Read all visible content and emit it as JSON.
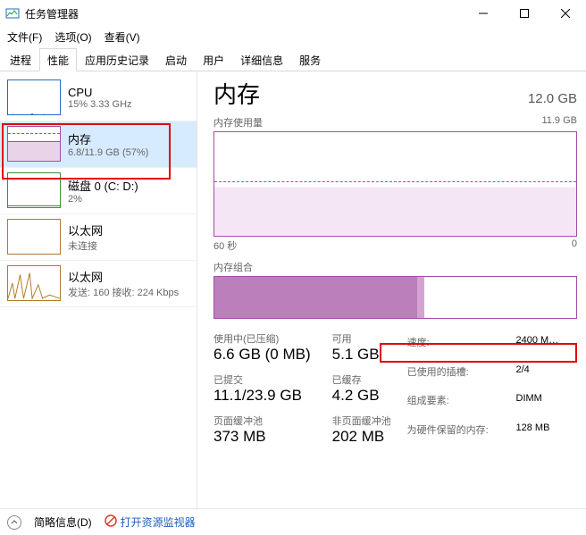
{
  "window": {
    "title": "任务管理器"
  },
  "menu": {
    "file": "文件(F)",
    "options": "选项(O)",
    "view": "查看(V)"
  },
  "tabs": [
    "进程",
    "性能",
    "应用历史记录",
    "启动",
    "用户",
    "详细信息",
    "服务"
  ],
  "sidebar": {
    "cpu": {
      "name": "CPU",
      "sub": "15% 3.33 GHz"
    },
    "mem": {
      "name": "内存",
      "sub": "6.8/11.9 GB (57%)"
    },
    "disk": {
      "name": "磁盘 0 (C: D:)",
      "sub": "2%"
    },
    "eth1": {
      "name": "以太网",
      "sub": "未连接"
    },
    "eth2": {
      "name": "以太网",
      "sub": "发送: 160 接收: 224 Kbps"
    }
  },
  "main": {
    "title": "内存",
    "total": "12.0 GB",
    "usage_label": "内存使用量",
    "usage_max": "11.9 GB",
    "x_left": "60 秒",
    "x_right": "0",
    "comp_label": "内存组合"
  },
  "stats": {
    "in_use_label": "使用中(已压缩)",
    "in_use": "6.6 GB (0 MB)",
    "avail_label": "可用",
    "avail": "5.1 GB",
    "committed_label": "已提交",
    "committed": "11.1/23.9 GB",
    "cached_label": "已缓存",
    "cached": "4.2 GB",
    "paged_label": "页面缓冲池",
    "paged": "373 MB",
    "nonpaged_label": "非页面缓冲池",
    "nonpaged": "202 MB"
  },
  "right": {
    "speed_k": "速度:",
    "speed_v": "2400 M…",
    "slots_k": "已使用的插槽:",
    "slots_v": "2/4",
    "form_k": "组成要素:",
    "form_v": "DIMM",
    "hw_k": "为硬件保留的内存:",
    "hw_v": "128 MB"
  },
  "footer": {
    "fewer": "简略信息(D)",
    "resmon": "打开资源监视器"
  },
  "chart_data": {
    "type": "area",
    "title": "内存使用量",
    "ylabel": "GB",
    "ylim": [
      0,
      11.9
    ],
    "x": [
      60,
      0
    ],
    "series": [
      {
        "name": "In use",
        "current": 6.8,
        "max": 11.9,
        "percent": 57
      }
    ]
  }
}
